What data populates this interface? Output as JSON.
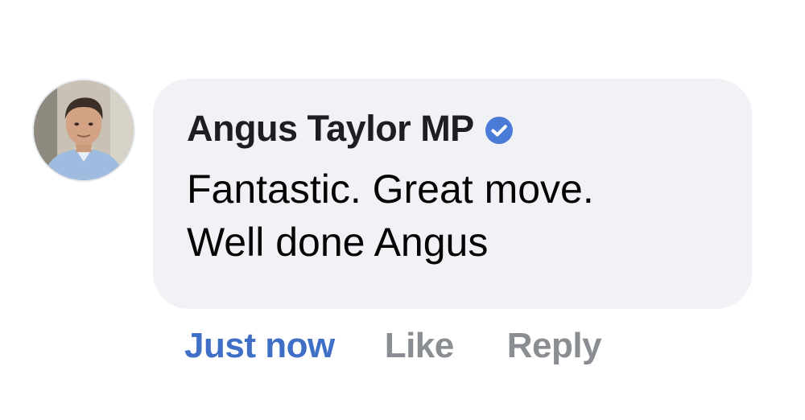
{
  "comment": {
    "author": {
      "name": "Angus Taylor MP",
      "verified": true,
      "verified_icon": "verified-badge-icon",
      "verified_color": "#4a7bd6"
    },
    "text_lines": [
      "Fantastic. Great move.",
      "Well done Angus"
    ],
    "bubble_color": "#f0f2f5",
    "actions": {
      "timestamp": "Just now",
      "like": "Like",
      "reply": "Reply"
    },
    "colors": {
      "timestamp": "#3f6fc6",
      "action": "#8a8d91"
    }
  }
}
